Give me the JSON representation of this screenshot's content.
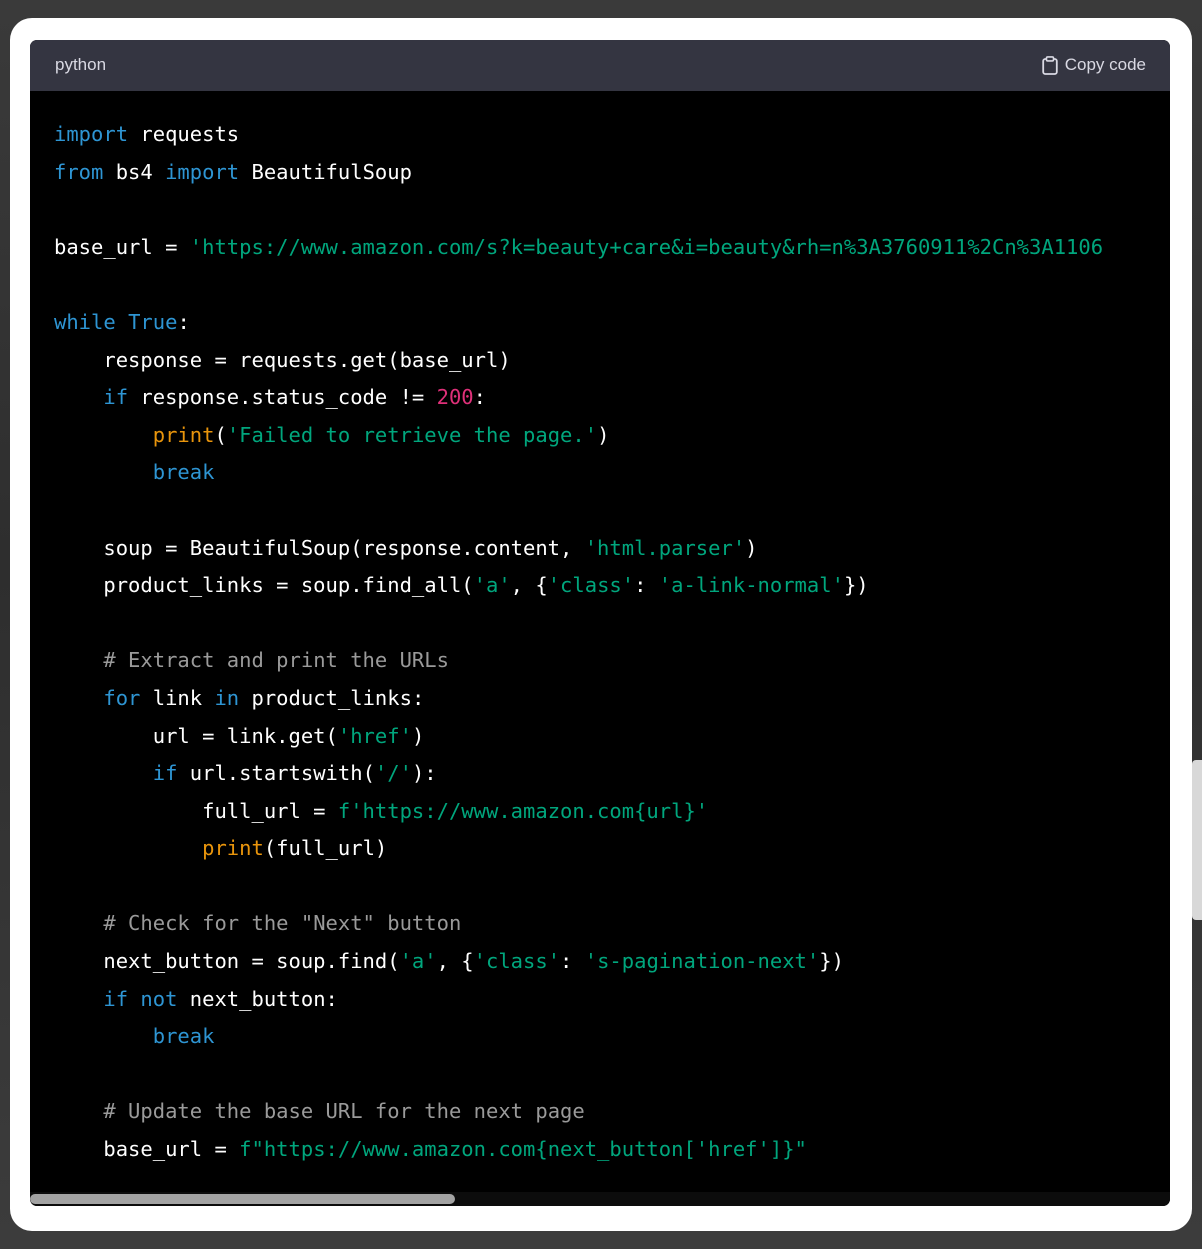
{
  "code_block": {
    "language": "python",
    "copy_label": "Copy code",
    "colors": {
      "keyword": "#2e95d3",
      "string": "#00a67d",
      "number": "#df3079",
      "builtin": "#e9950c",
      "comment": "#9a9a9a",
      "text": "#ffffff",
      "header_bg": "#343541",
      "code_bg": "#000000"
    },
    "lines": [
      [
        {
          "t": "kw",
          "v": "import"
        },
        {
          "t": "id",
          "v": " requests"
        }
      ],
      [
        {
          "t": "kw",
          "v": "from"
        },
        {
          "t": "id",
          "v": " bs4 "
        },
        {
          "t": "kw",
          "v": "import"
        },
        {
          "t": "id",
          "v": " BeautifulSoup"
        }
      ],
      [],
      [
        {
          "t": "id",
          "v": "base_url = "
        },
        {
          "t": "str",
          "v": "'https://www.amazon.com/s?k=beauty+care&i=beauty&rh=n%3A3760911%2Cn%3A1106"
        }
      ],
      [],
      [
        {
          "t": "kw",
          "v": "while"
        },
        {
          "t": "id",
          "v": " "
        },
        {
          "t": "kw",
          "v": "True"
        },
        {
          "t": "id",
          "v": ":"
        }
      ],
      [
        {
          "t": "id",
          "v": "    response = requests.get(base_url)"
        }
      ],
      [
        {
          "t": "id",
          "v": "    "
        },
        {
          "t": "kw",
          "v": "if"
        },
        {
          "t": "id",
          "v": " response.status_code != "
        },
        {
          "t": "num",
          "v": "200"
        },
        {
          "t": "id",
          "v": ":"
        }
      ],
      [
        {
          "t": "id",
          "v": "        "
        },
        {
          "t": "bi",
          "v": "print"
        },
        {
          "t": "id",
          "v": "("
        },
        {
          "t": "str",
          "v": "'Failed to retrieve the page.'"
        },
        {
          "t": "id",
          "v": ")"
        }
      ],
      [
        {
          "t": "id",
          "v": "        "
        },
        {
          "t": "kw",
          "v": "break"
        }
      ],
      [],
      [
        {
          "t": "id",
          "v": "    soup = BeautifulSoup(response.content, "
        },
        {
          "t": "str",
          "v": "'html.parser'"
        },
        {
          "t": "id",
          "v": ")"
        }
      ],
      [
        {
          "t": "id",
          "v": "    product_links = soup.find_all("
        },
        {
          "t": "str",
          "v": "'a'"
        },
        {
          "t": "id",
          "v": ", {"
        },
        {
          "t": "str",
          "v": "'class'"
        },
        {
          "t": "id",
          "v": ": "
        },
        {
          "t": "str",
          "v": "'a-link-normal'"
        },
        {
          "t": "id",
          "v": "})"
        }
      ],
      [],
      [
        {
          "t": "id",
          "v": "    "
        },
        {
          "t": "cm",
          "v": "# Extract and print the URLs"
        }
      ],
      [
        {
          "t": "id",
          "v": "    "
        },
        {
          "t": "kw",
          "v": "for"
        },
        {
          "t": "id",
          "v": " link "
        },
        {
          "t": "kw",
          "v": "in"
        },
        {
          "t": "id",
          "v": " product_links:"
        }
      ],
      [
        {
          "t": "id",
          "v": "        url = link.get("
        },
        {
          "t": "str",
          "v": "'href'"
        },
        {
          "t": "id",
          "v": ")"
        }
      ],
      [
        {
          "t": "id",
          "v": "        "
        },
        {
          "t": "kw",
          "v": "if"
        },
        {
          "t": "id",
          "v": " url.startswith("
        },
        {
          "t": "str",
          "v": "'/'"
        },
        {
          "t": "id",
          "v": "):"
        }
      ],
      [
        {
          "t": "id",
          "v": "            full_url = "
        },
        {
          "t": "str",
          "v": "f'https://www.amazon.com{url}'"
        }
      ],
      [
        {
          "t": "id",
          "v": "            "
        },
        {
          "t": "bi",
          "v": "print"
        },
        {
          "t": "id",
          "v": "(full_url)"
        }
      ],
      [],
      [
        {
          "t": "id",
          "v": "    "
        },
        {
          "t": "cm",
          "v": "# Check for the \"Next\" button"
        }
      ],
      [
        {
          "t": "id",
          "v": "    next_button = soup.find("
        },
        {
          "t": "str",
          "v": "'a'"
        },
        {
          "t": "id",
          "v": ", {"
        },
        {
          "t": "str",
          "v": "'class'"
        },
        {
          "t": "id",
          "v": ": "
        },
        {
          "t": "str",
          "v": "'s-pagination-next'"
        },
        {
          "t": "id",
          "v": "})"
        }
      ],
      [
        {
          "t": "id",
          "v": "    "
        },
        {
          "t": "kw",
          "v": "if"
        },
        {
          "t": "id",
          "v": " "
        },
        {
          "t": "kw",
          "v": "not"
        },
        {
          "t": "id",
          "v": " next_button:"
        }
      ],
      [
        {
          "t": "id",
          "v": "        "
        },
        {
          "t": "kw",
          "v": "break"
        }
      ],
      [],
      [
        {
          "t": "id",
          "v": "    "
        },
        {
          "t": "cm",
          "v": "# Update the base URL for the next page"
        }
      ],
      [
        {
          "t": "id",
          "v": "    base_url = "
        },
        {
          "t": "str",
          "v": "f\"https://www.amazon.com{next_button['href']}\""
        }
      ]
    ]
  }
}
